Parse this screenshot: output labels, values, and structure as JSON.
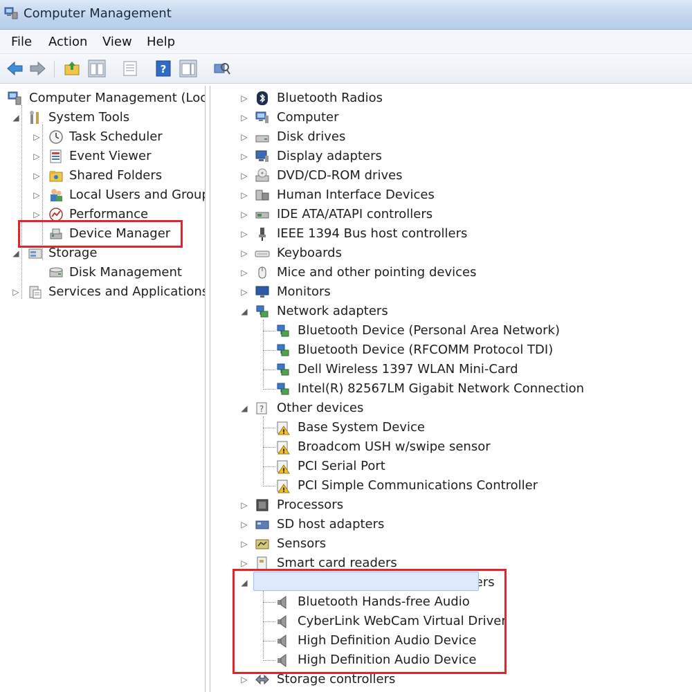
{
  "window": {
    "title": "Computer Management"
  },
  "menu": [
    "File",
    "Action",
    "View",
    "Help"
  ],
  "left_tree": [
    {
      "label": "Computer Management (Local",
      "icon": "computer-management-icon",
      "arrow": ""
    },
    {
      "label": "System Tools",
      "icon": "tools-icon",
      "arrow": "◢"
    },
    {
      "label": "Task Scheduler",
      "icon": "clock-icon",
      "arrow": "▷"
    },
    {
      "label": "Event Viewer",
      "icon": "event-viewer-icon",
      "arrow": "▷"
    },
    {
      "label": "Shared Folders",
      "icon": "shared-folder-icon",
      "arrow": "▷"
    },
    {
      "label": "Local Users and Groups",
      "icon": "users-icon",
      "arrow": "▷"
    },
    {
      "label": "Performance",
      "icon": "performance-icon",
      "arrow": "▷"
    },
    {
      "label": "Device Manager",
      "icon": "device-manager-icon",
      "arrow": ""
    },
    {
      "label": "Storage",
      "icon": "storage-icon",
      "arrow": "◢"
    },
    {
      "label": "Disk Management",
      "icon": "disk-icon",
      "arrow": ""
    },
    {
      "label": "Services and Applications",
      "icon": "services-icon",
      "arrow": "▷"
    }
  ],
  "right_tree": [
    {
      "label": "Bluetooth Radios",
      "icon": "bluetooth-icon",
      "arrow": "▷",
      "level": 0
    },
    {
      "label": "Computer",
      "icon": "computer-icon",
      "arrow": "▷",
      "level": 0
    },
    {
      "label": "Disk drives",
      "icon": "disk-drive-icon",
      "arrow": "▷",
      "level": 0
    },
    {
      "label": "Display adapters",
      "icon": "display-icon",
      "arrow": "▷",
      "level": 0
    },
    {
      "label": "DVD/CD-ROM drives",
      "icon": "dvd-icon",
      "arrow": "▷",
      "level": 0
    },
    {
      "label": "Human Interface Devices",
      "icon": "hid-icon",
      "arrow": "▷",
      "level": 0
    },
    {
      "label": "IDE ATA/ATAPI controllers",
      "icon": "ide-icon",
      "arrow": "▷",
      "level": 0
    },
    {
      "label": "IEEE 1394 Bus host controllers",
      "icon": "ieee-icon",
      "arrow": "▷",
      "level": 0
    },
    {
      "label": "Keyboards",
      "icon": "keyboard-icon",
      "arrow": "▷",
      "level": 0
    },
    {
      "label": "Mice and other pointing devices",
      "icon": "mouse-icon",
      "arrow": "▷",
      "level": 0
    },
    {
      "label": "Monitors",
      "icon": "monitor-icon",
      "arrow": "▷",
      "level": 0
    },
    {
      "label": "Network adapters",
      "icon": "network-icon",
      "arrow": "◢",
      "level": 0
    },
    {
      "label": "Bluetooth Device (Personal Area Network)",
      "icon": "network-icon",
      "arrow": "",
      "level": 1
    },
    {
      "label": "Bluetooth Device (RFCOMM Protocol TDI)",
      "icon": "network-icon",
      "arrow": "",
      "level": 1
    },
    {
      "label": "Dell Wireless 1397 WLAN Mini-Card",
      "icon": "network-icon",
      "arrow": "",
      "level": 1
    },
    {
      "label": "Intel(R) 82567LM Gigabit Network Connection",
      "icon": "network-icon",
      "arrow": "",
      "level": 1
    },
    {
      "label": "Other devices",
      "icon": "other-devices-icon",
      "arrow": "◢",
      "level": 0
    },
    {
      "label": "Base System Device",
      "icon": "warning-device-icon",
      "arrow": "",
      "level": 1
    },
    {
      "label": "Broadcom USH w/swipe sensor",
      "icon": "warning-device-icon",
      "arrow": "",
      "level": 1
    },
    {
      "label": "PCI Serial Port",
      "icon": "warning-device-icon",
      "arrow": "",
      "level": 1
    },
    {
      "label": "PCI Simple Communications Controller",
      "icon": "warning-device-icon",
      "arrow": "",
      "level": 1
    },
    {
      "label": "Processors",
      "icon": "processor-icon",
      "arrow": "▷",
      "level": 0
    },
    {
      "label": "SD host adapters",
      "icon": "sd-icon",
      "arrow": "▷",
      "level": 0
    },
    {
      "label": "Sensors",
      "icon": "sensor-icon",
      "arrow": "▷",
      "level": 0
    },
    {
      "label": "Smart card readers",
      "icon": "smartcard-icon",
      "arrow": "▷",
      "level": 0
    },
    {
      "label": "Sound, video and game controllers",
      "icon": "speaker-icon",
      "arrow": "◢",
      "level": 0
    },
    {
      "label": "Bluetooth Hands-free Audio",
      "icon": "speaker-icon",
      "arrow": "",
      "level": 1
    },
    {
      "label": "CyberLink WebCam Virtual Driver",
      "icon": "speaker-icon",
      "arrow": "",
      "level": 1
    },
    {
      "label": "High Definition Audio Device",
      "icon": "speaker-icon",
      "arrow": "",
      "level": 1
    },
    {
      "label": "High Definition Audio Device",
      "icon": "speaker-icon",
      "arrow": "",
      "level": 1
    },
    {
      "label": "Storage controllers",
      "icon": "storage-controller-icon",
      "arrow": "▷",
      "level": 0
    }
  ],
  "colors": {
    "highlight": "#e0262c",
    "selection": "#dbe9fa",
    "titlebar": "#c2d6ee"
  }
}
